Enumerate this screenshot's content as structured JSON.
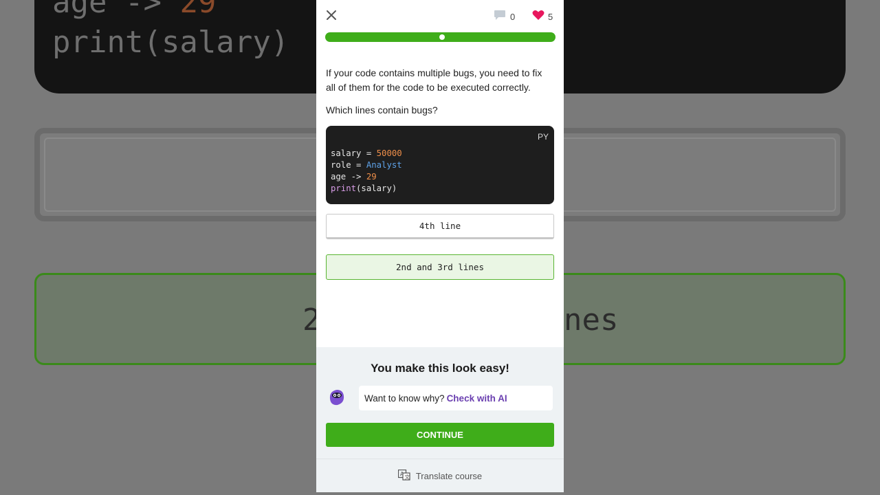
{
  "background": {
    "code_lines": [
      "age -> 29",
      "print(salary)"
    ],
    "option_text": "2nd and 3rd lines"
  },
  "topbar": {
    "comments_count": "0",
    "hearts_count": "5",
    "accent_heart": "#e8175d"
  },
  "progress": {
    "value": 0.5,
    "color": "#3fad1a"
  },
  "lesson": {
    "intro": "If your code contains multiple bugs, you need to fix all of them for the code to be executed correctly.",
    "question": "Which lines contain bugs?"
  },
  "code": {
    "language": "PY",
    "lines": [
      {
        "var": "salary",
        "op": " = ",
        "value": "50000"
      },
      {
        "var": "role",
        "op": " = ",
        "value": "Analyst"
      },
      {
        "var": "age",
        "op": " -> ",
        "value": "29"
      },
      {
        "fn": "print",
        "args": "(salary)"
      }
    ]
  },
  "options": [
    {
      "label": "4th line",
      "selected": false
    },
    {
      "label": "2nd and 3rd lines",
      "selected": true
    }
  ],
  "feedback": {
    "title": "You make this look easy!",
    "ai_prompt": "Want to know why?",
    "ai_link": "Check with AI",
    "continue_label": "CONTINUE"
  },
  "footer": {
    "translate_label": "Translate course"
  }
}
